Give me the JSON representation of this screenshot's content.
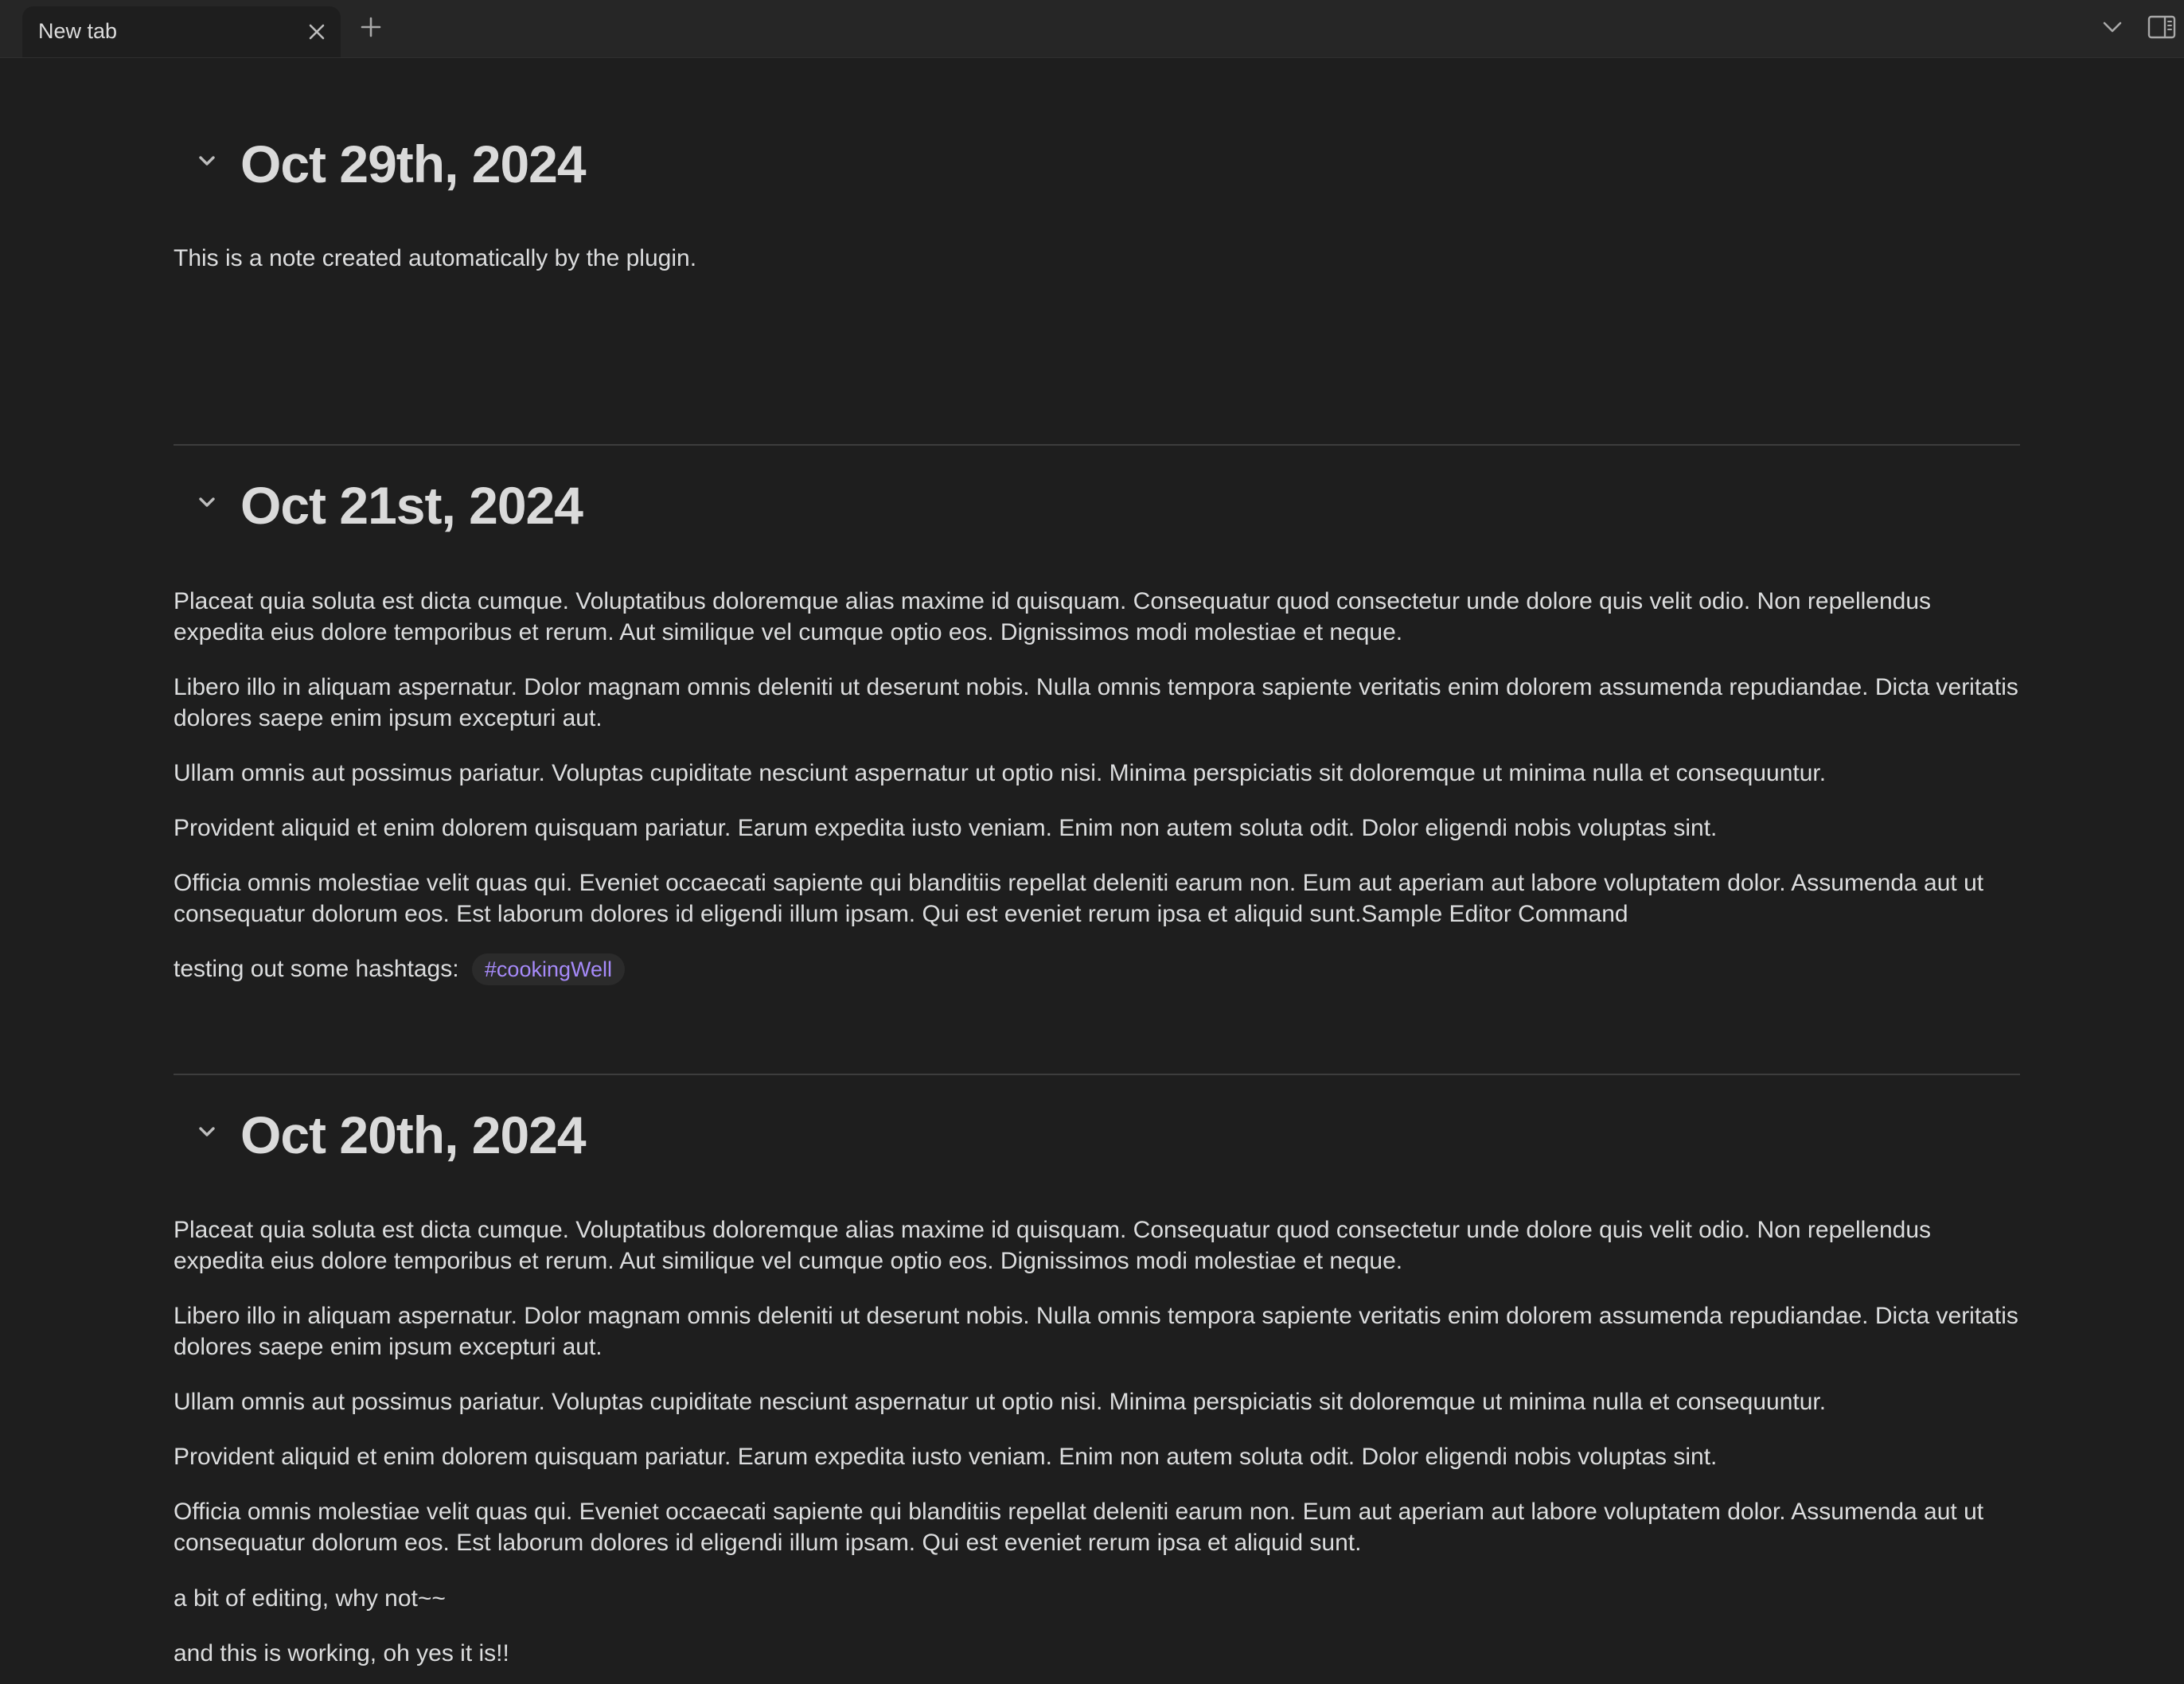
{
  "tabbar": {
    "active_tab_title": "New tab"
  },
  "icons": {
    "tab_close": "close-icon",
    "new_tab": "plus-icon",
    "tab_list": "chevron-down-icon",
    "sidebar_toggle": "sidebar-toggle-icon",
    "collapse": "chevron-down-icon"
  },
  "colors": {
    "background": "#1e1e1e",
    "tab_bar": "#262626",
    "text": "#dcddde",
    "tag_text": "#a68af9",
    "tag_background": "#2b2b2b",
    "divider": "#3d3d3d"
  },
  "notes": [
    {
      "title": "Oct 29th, 2024",
      "paragraphs": [
        "This is a note created automatically by the plugin."
      ]
    },
    {
      "title": "Oct 21st, 2024",
      "paragraphs": [
        "Placeat quia soluta est dicta cumque. Voluptatibus doloremque alias maxime id quisquam. Consequatur quod consectetur unde dolore quis velit odio. Non repellendus expedita eius dolore temporibus et rerum. Aut similique vel cumque optio eos. Dignissimos modi molestiae et neque.",
        "Libero illo in aliquam aspernatur. Dolor magnam omnis deleniti ut deserunt nobis. Nulla omnis tempora sapiente veritatis enim dolorem assumenda repudiandae. Dicta veritatis dolores saepe enim ipsum excepturi aut.",
        "Ullam omnis aut possimus pariatur. Voluptas cupiditate nesciunt aspernatur ut optio nisi. Minima perspiciatis sit doloremque ut minima nulla et consequuntur.",
        "Provident aliquid et enim dolorem quisquam pariatur. Earum expedita iusto veniam. Enim non autem soluta odit. Dolor eligendi nobis voluptas sint.",
        "Officia omnis molestiae velit quas qui. Eveniet occaecati sapiente qui blanditiis repellat deleniti earum non. Eum aut aperiam aut labore voluptatem dolor. Assumenda aut ut consequatur dolorum eos. Est laborum dolores id eligendi illum ipsam. Qui est eveniet rerum ipsa et aliquid sunt.Sample Editor Command"
      ],
      "hashtag_line": "testing out some hashtags:",
      "hashtag": "#cookingWell"
    },
    {
      "title": "Oct 20th, 2024",
      "paragraphs": [
        "Placeat quia soluta est dicta cumque. Voluptatibus doloremque alias maxime id quisquam. Consequatur quod consectetur unde dolore quis velit odio. Non repellendus expedita eius dolore temporibus et rerum. Aut similique vel cumque optio eos. Dignissimos modi molestiae et neque.",
        "Libero illo in aliquam aspernatur. Dolor magnam omnis deleniti ut deserunt nobis. Nulla omnis tempora sapiente veritatis enim dolorem assumenda repudiandae. Dicta veritatis dolores saepe enim ipsum excepturi aut.",
        "Ullam omnis aut possimus pariatur. Voluptas cupiditate nesciunt aspernatur ut optio nisi. Minima perspiciatis sit doloremque ut minima nulla et consequuntur.",
        "Provident aliquid et enim dolorem quisquam pariatur. Earum expedita iusto veniam. Enim non autem soluta odit. Dolor eligendi nobis voluptas sint.",
        "Officia omnis molestiae velit quas qui. Eveniet occaecati sapiente qui blanditiis repellat deleniti earum non. Eum aut aperiam aut labore voluptatem dolor. Assumenda aut ut consequatur dolorum eos. Est laborum dolores id eligendi illum ipsam. Qui est eveniet rerum ipsa et aliquid sunt.",
        "a bit of editing, why not~~",
        "and this is working, oh yes it is!!"
      ]
    }
  ]
}
